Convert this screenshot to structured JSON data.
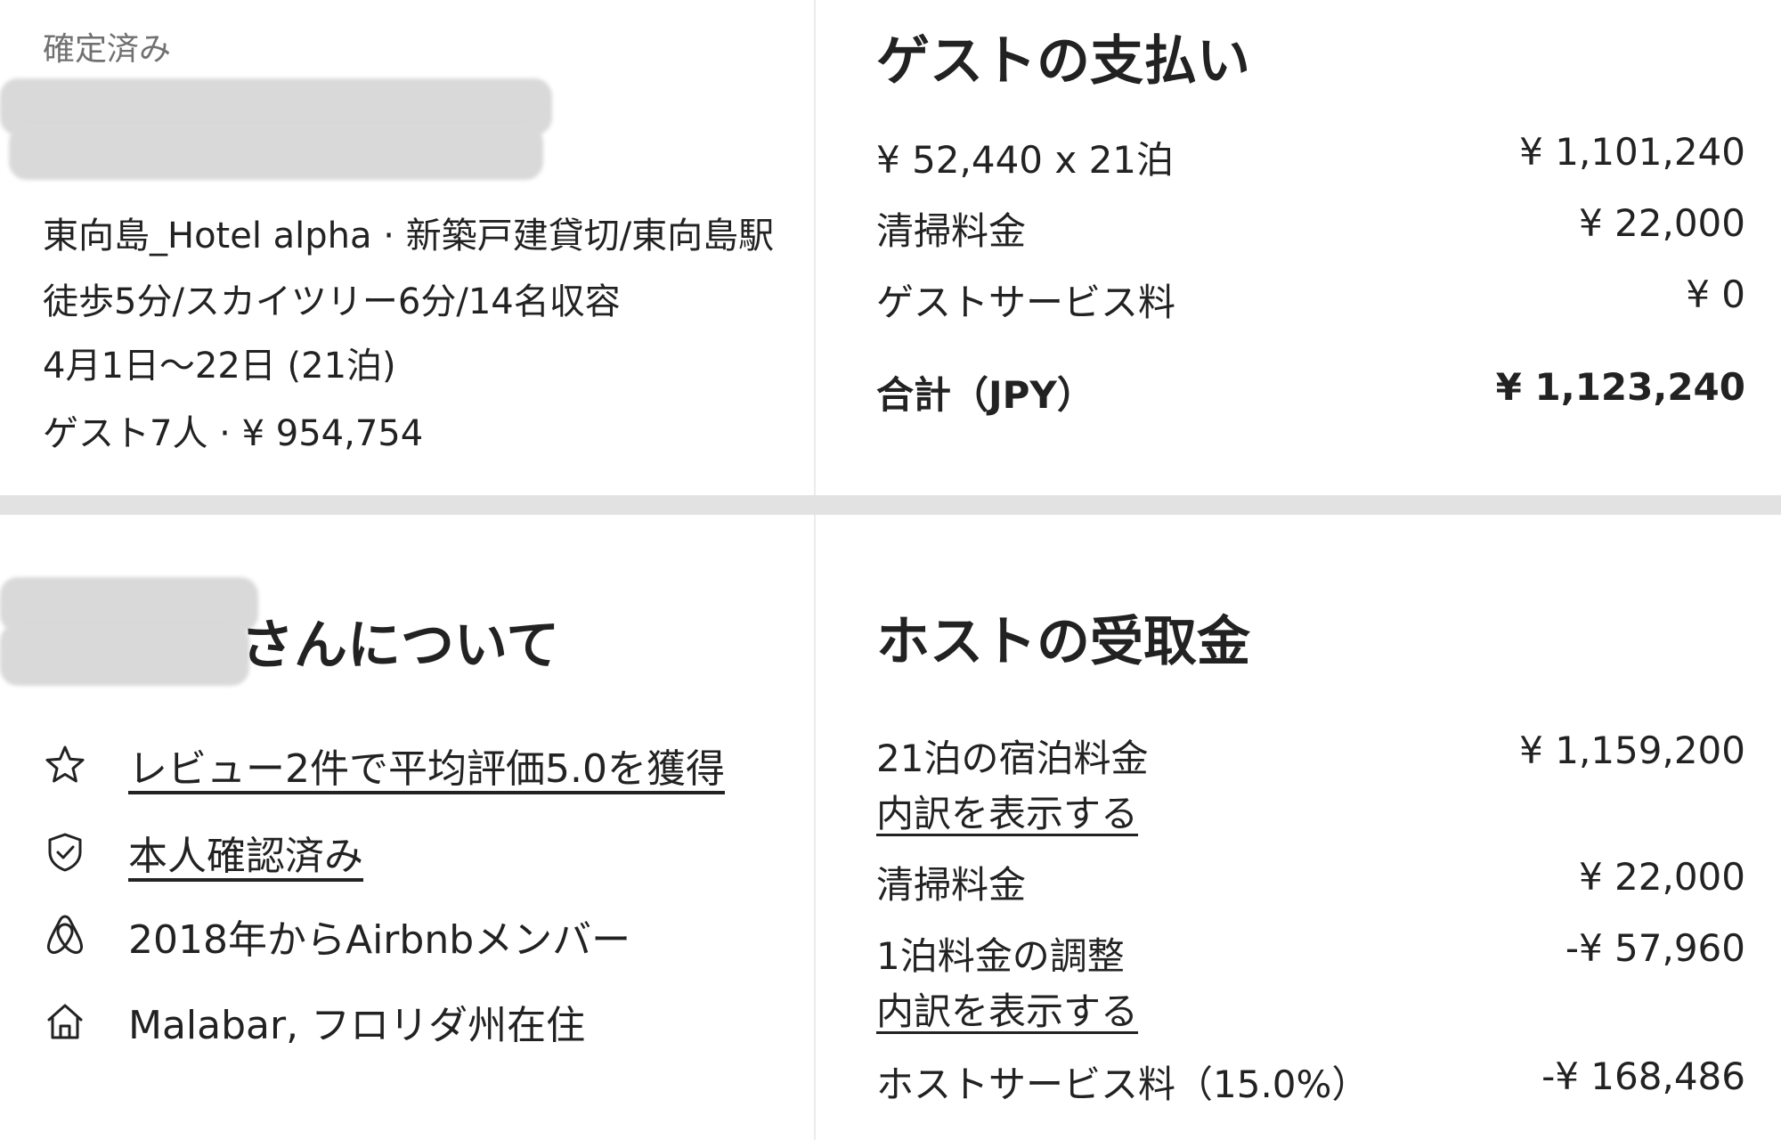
{
  "reservation": {
    "status": "確定済み",
    "listing_line1": "東向島_Hotel alpha · 新築戸建貸切/東向島駅",
    "listing_line2": "徒歩5分/スカイツリー6分/14名収容",
    "dates": "4月1日〜22日 (21泊)",
    "guests_price": "ゲスト7人 · ¥ 954,754"
  },
  "guest_payment": {
    "title": "ゲストの支払い",
    "rows": [
      {
        "label": "¥ 52,440 x 21泊",
        "value": "¥ 1,101,240"
      },
      {
        "label": "清掃料金",
        "value": "¥ 22,000"
      },
      {
        "label": "ゲストサービス料",
        "value": "¥ 0"
      }
    ],
    "total": {
      "label": "合計（JPY）",
      "value": "¥ 1,123,240"
    }
  },
  "about": {
    "title": "さんについて",
    "items": [
      {
        "icon": "star-icon",
        "text": "レビュー2件で平均評価5.0を獲得",
        "link": true
      },
      {
        "icon": "shield-check-icon",
        "text": "本人確認済み",
        "link": true
      },
      {
        "icon": "airbnb-logo-icon",
        "text": "2018年からAirbnbメンバー",
        "link": false
      },
      {
        "icon": "home-icon",
        "text": "Malabar, フロリダ州在住",
        "link": false
      }
    ]
  },
  "host_payout": {
    "title": "ホストの受取金",
    "rows": [
      {
        "label": "21泊の宿泊料金",
        "value": "¥ 1,159,200",
        "link": "内訳を表示する"
      },
      {
        "label": "清掃料金",
        "value": "¥ 22,000"
      },
      {
        "label": "1泊料金の調整",
        "value": "-¥ 57,960",
        "link": "内訳を表示する"
      },
      {
        "label": "ホストサービス料（15.0%）",
        "value": "-¥ 168,486"
      }
    ]
  }
}
